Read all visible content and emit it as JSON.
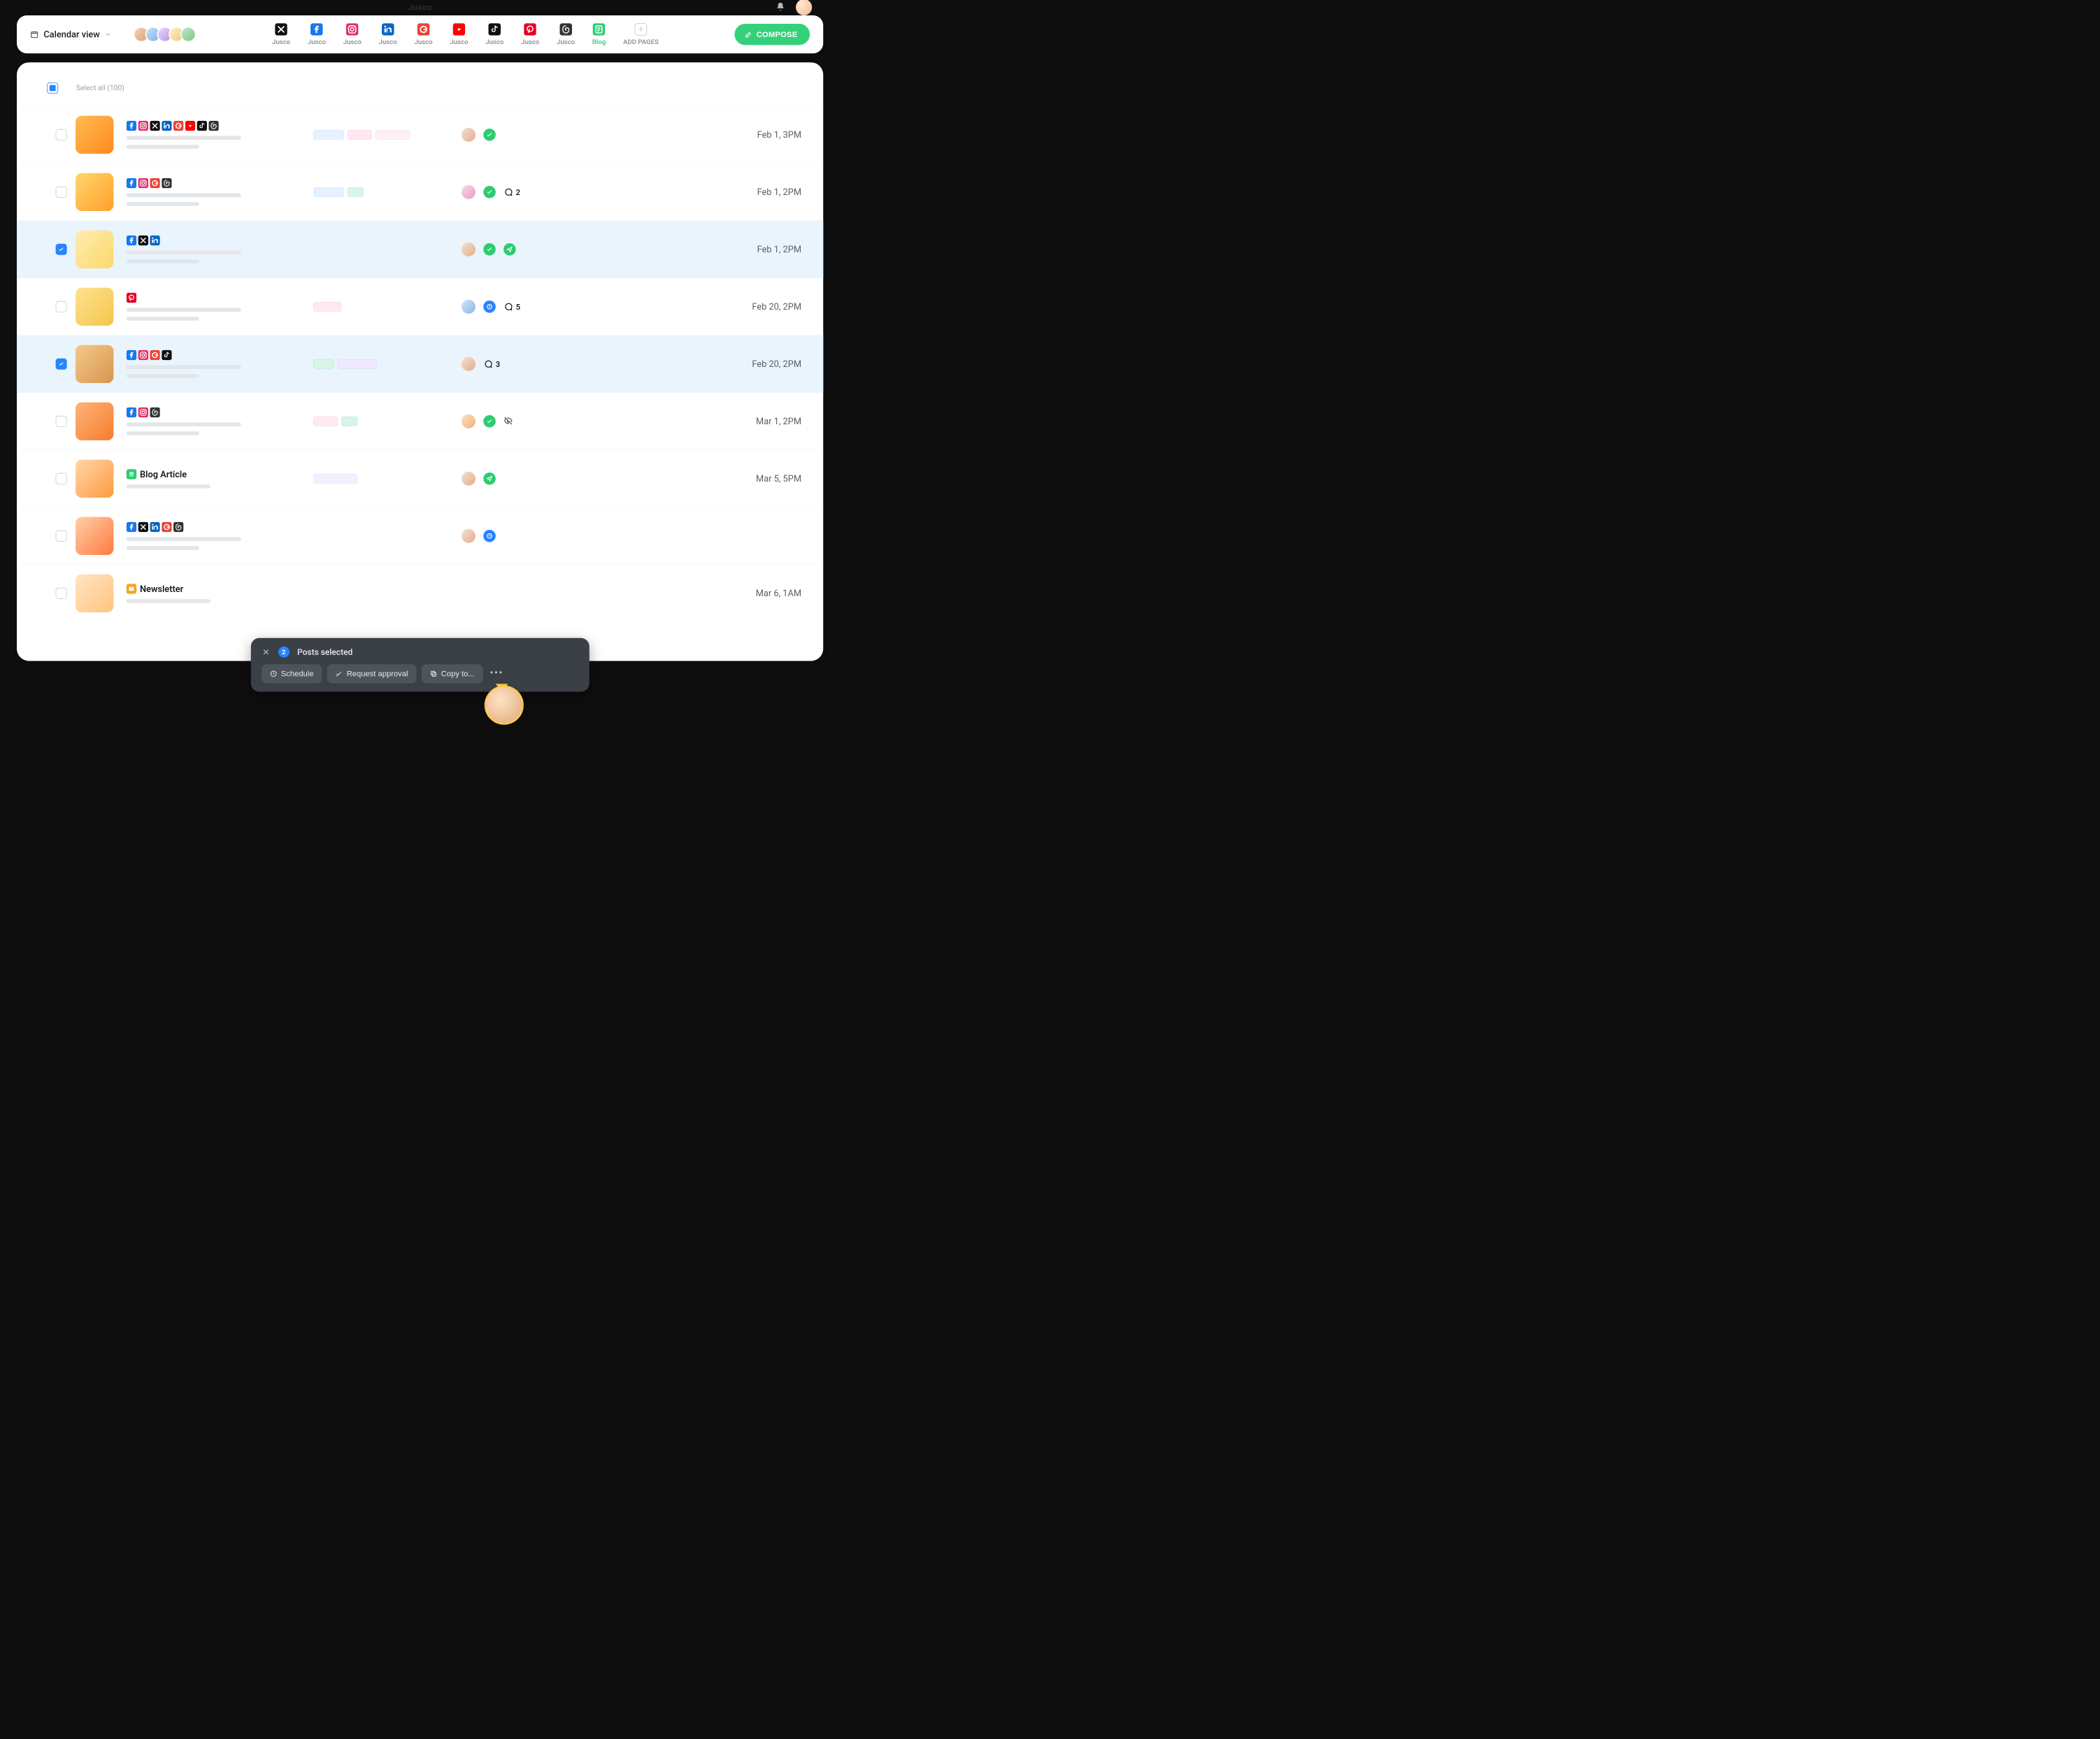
{
  "brand": "Jusco",
  "header": {
    "view_label": "Calendar view",
    "compose_label": "COMPOSE",
    "add_pages_label": "ADD PAGES",
    "pages": [
      {
        "label": "Jusco",
        "network": "x"
      },
      {
        "label": "Jusco",
        "network": "facebook"
      },
      {
        "label": "Jusco",
        "network": "instagram"
      },
      {
        "label": "Jusco",
        "network": "linkedin"
      },
      {
        "label": "Jusco",
        "network": "google"
      },
      {
        "label": "Jusco",
        "network": "youtube"
      },
      {
        "label": "Jusco",
        "network": "tiktok"
      },
      {
        "label": "Jusco",
        "network": "pinterest"
      },
      {
        "label": "Jusco",
        "network": "threads"
      },
      {
        "label": "Blog",
        "network": "blog"
      }
    ]
  },
  "list": {
    "select_all_label": "Select all (100)",
    "select_all_state": "partial",
    "posts": [
      {
        "date": "Feb 1, 3PM",
        "checked": false,
        "networks": [
          "facebook",
          "instagram",
          "x",
          "linkedin",
          "google",
          "youtube",
          "tiktok",
          "threads"
        ],
        "tags": [
          "blue",
          "pink",
          "lpink"
        ],
        "comments": null,
        "status": "approved",
        "avatar": "m1"
      },
      {
        "date": "Feb 1, 2PM",
        "checked": false,
        "networks": [
          "facebook",
          "instagram",
          "google",
          "threads"
        ],
        "tags": [
          "blue",
          "teal"
        ],
        "comments": 2,
        "status": "approved",
        "avatar": "m2"
      },
      {
        "date": "Feb 1, 2PM",
        "checked": true,
        "networks": [
          "facebook",
          "x",
          "linkedin"
        ],
        "tags": [],
        "comments": null,
        "status": "sent",
        "avatar": "m1"
      },
      {
        "date": "Feb 20, 2PM",
        "checked": false,
        "networks": [
          "pinterest"
        ],
        "tags": [
          "pinkw"
        ],
        "comments": 5,
        "status": "scheduled",
        "avatar": "m3"
      },
      {
        "date": "Feb 20, 2PM",
        "checked": true,
        "networks": [
          "facebook",
          "instagram",
          "google",
          "tiktok"
        ],
        "tags": [
          "mteal",
          "violet"
        ],
        "comments": 3,
        "status": "none",
        "avatar": "m1"
      },
      {
        "date": "Mar 1, 2PM",
        "checked": false,
        "networks": [
          "facebook",
          "instagram",
          "threads"
        ],
        "tags": [
          "pink",
          "mint"
        ],
        "comments": null,
        "status": "hidden",
        "avatar": "m4"
      },
      {
        "date": "Mar 5, 5PM",
        "checked": false,
        "title": "Blog Article",
        "title_kind": "blog",
        "networks": [],
        "tags": [
          "vio"
        ],
        "comments": null,
        "status": "sent-only",
        "avatar": "m1"
      },
      {
        "date": "",
        "checked": false,
        "networks": [
          "facebook",
          "x",
          "linkedin",
          "google",
          "threads"
        ],
        "tags": [],
        "comments": null,
        "status": "scheduled-only",
        "avatar": "m1"
      },
      {
        "date": "Mar 6, 1AM",
        "checked": false,
        "title": "Newsletter",
        "title_kind": "news",
        "networks": [],
        "tags": [],
        "comments": null,
        "status": "none",
        "avatar": "none"
      }
    ]
  },
  "action_bar": {
    "count": 2,
    "label": "Posts selected",
    "buttons": {
      "schedule": "Schedule",
      "request_approval": "Request approval",
      "copy_to": "Copy to..."
    }
  },
  "net_colors": {
    "x": "#0f0f0f",
    "facebook": "#1877f2",
    "instagram": "#e1306c",
    "linkedin": "#0a66c2",
    "google": "#ea4335",
    "youtube": "#ff0000",
    "tiktok": "#0f0f0f",
    "pinterest": "#e60023",
    "threads": "#333333",
    "blog": "#2ecc71"
  }
}
